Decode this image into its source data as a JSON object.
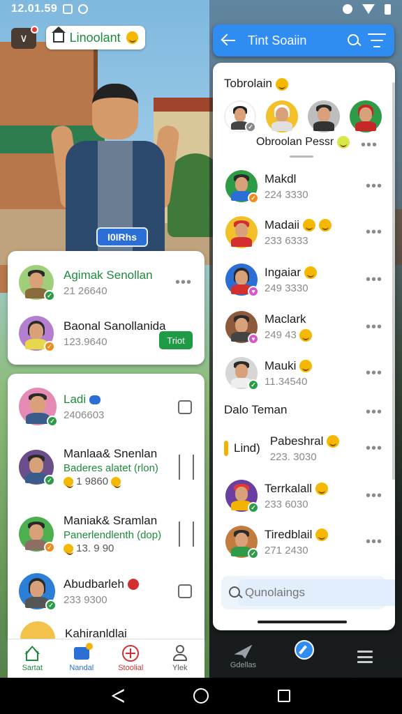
{
  "status_bar": {
    "time": "12.01.59"
  },
  "left": {
    "title": "Linoolant",
    "hero_badge": "I0IRhs",
    "card_a": [
      {
        "name": "Agimak Senollan",
        "meta": "21 26640",
        "action": ""
      },
      {
        "name": "Baonal Sanollanida",
        "meta": "123.9640",
        "action": "Triot"
      }
    ],
    "card_b": [
      {
        "name": "Ladi",
        "line2": "",
        "meta": "2406603"
      },
      {
        "name": "Manlaa& Snenlan",
        "line2": "Baderes alatet (rlon)",
        "meta": "1 9860"
      },
      {
        "name": "Maniak& Sramlan",
        "line2": "Panerlendlenth (dop)",
        "meta": "13. 9 90"
      },
      {
        "name": "Abudbarleh",
        "line2": "",
        "meta": "233 9300"
      },
      {
        "name": "Kahiranldlai",
        "line2": "",
        "meta": ""
      }
    ],
    "nav": [
      {
        "label": "Sartat",
        "color": "#1f8a3e"
      },
      {
        "label": "Nandal",
        "color": "#2b6fd6"
      },
      {
        "label": "Stoolial",
        "color": "#d32f2f"
      },
      {
        "label": "Ylek",
        "color": "#555555"
      }
    ]
  },
  "right": {
    "header_title": "Tint Soaiin",
    "section1_title": "Tobrolain",
    "obrolan_label": "Obroolan Pessr",
    "contacts": [
      {
        "name": "Makdl",
        "meta": "224 3330"
      },
      {
        "name": "Madaii",
        "meta": "233 6333"
      },
      {
        "name": "Ingaiar",
        "meta": "249 3330"
      },
      {
        "name": "Maclark",
        "meta": "249 43"
      },
      {
        "name": "Mauki",
        "meta": "11.34540"
      }
    ],
    "section2_title": "Dalo Teman",
    "friends": [
      {
        "name": "Pabeshral",
        "meta": "223. 3030",
        "prefix": "Lind)"
      },
      {
        "name": "Terrkalall",
        "meta": "233 6030",
        "prefix": ""
      },
      {
        "name": "Tiredblail",
        "meta": "271 2430",
        "prefix": ""
      }
    ],
    "search_placeholder": "Qunolaings",
    "nav": [
      {
        "label": "Gdellas"
      }
    ]
  },
  "colors": {
    "accent_blue": "#2f8cf0",
    "accent_green": "#1f8a3e"
  }
}
